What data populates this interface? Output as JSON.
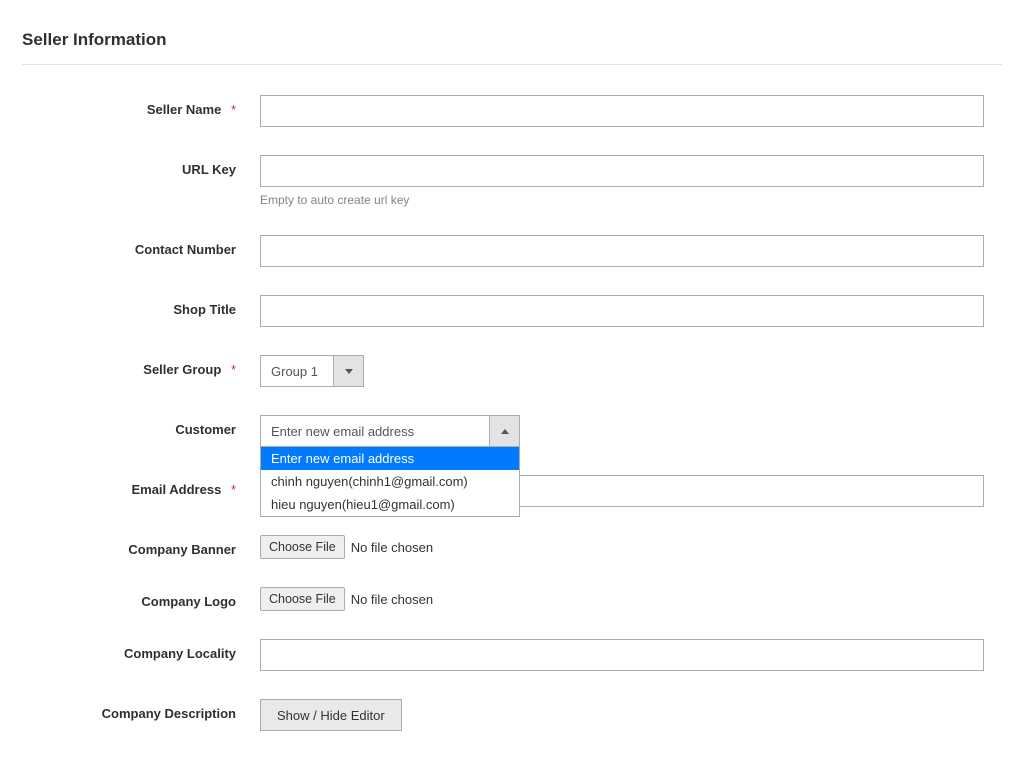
{
  "section_title": "Seller Information",
  "labels": {
    "seller_name": "Seller Name",
    "url_key": "URL Key",
    "contact_number": "Contact Number",
    "shop_title": "Shop Title",
    "seller_group": "Seller Group",
    "customer": "Customer",
    "email_address": "Email Address",
    "company_banner": "Company Banner",
    "company_logo": "Company Logo",
    "company_locality": "Company Locality",
    "company_description": "Company Description"
  },
  "required_mark": "*",
  "hints": {
    "url_key": "Empty to auto create url key"
  },
  "values": {
    "seller_name": "",
    "url_key": "",
    "contact_number": "",
    "shop_title": "",
    "seller_group": "Group 1",
    "customer": "Enter new email address",
    "email_address": "",
    "company_locality": ""
  },
  "customer_options": [
    "Enter new email address",
    "chinh nguyen(chinh1@gmail.com)",
    "hieu nguyen(hieu1@gmail.com)"
  ],
  "file": {
    "choose_label": "Choose File",
    "no_file": "No file chosen"
  },
  "buttons": {
    "show_hide_editor": "Show / Hide Editor"
  }
}
